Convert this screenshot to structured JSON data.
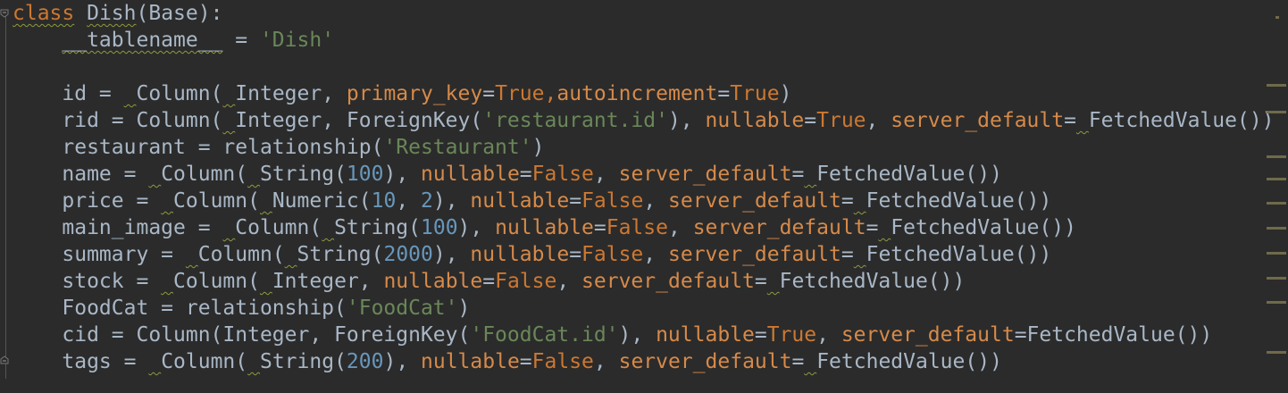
{
  "code": {
    "lines": [
      [
        {
          "t": "class",
          "c": "kw"
        },
        {
          "t": " ",
          "c": ""
        },
        {
          "t": "Dish",
          "c": ""
        },
        {
          "t": "(",
          "c": ""
        },
        {
          "t": "Base",
          "c": ""
        },
        {
          "t": "):",
          "c": ""
        }
      ],
      [
        {
          "t": "    ",
          "c": ""
        },
        {
          "t": "__tablename__",
          "c": ""
        },
        {
          "t": " = ",
          "c": ""
        },
        {
          "t": "'Dish'",
          "c": "str"
        }
      ],
      [],
      [
        {
          "t": "    id = ",
          "c": ""
        },
        {
          "t": " ",
          "c": ""
        },
        {
          "t": "Column(",
          "c": ""
        },
        {
          "t": " ",
          "c": ""
        },
        {
          "t": "Integer, ",
          "c": ""
        },
        {
          "t": "primary_key",
          "c": "param"
        },
        {
          "t": "=",
          "c": ""
        },
        {
          "t": "True",
          "c": "kw"
        },
        {
          "t": ",",
          "c": "kw"
        },
        {
          "t": "autoincrement",
          "c": "param"
        },
        {
          "t": "=",
          "c": ""
        },
        {
          "t": "True",
          "c": "kw"
        },
        {
          "t": ")",
          "c": ""
        }
      ],
      [
        {
          "t": "    rid = Column(",
          "c": ""
        },
        {
          "t": " ",
          "c": ""
        },
        {
          "t": "Integer, ForeignKey(",
          "c": ""
        },
        {
          "t": "'restaurant.id'",
          "c": "str"
        },
        {
          "t": "), ",
          "c": ""
        },
        {
          "t": "nullable",
          "c": "param"
        },
        {
          "t": "=",
          "c": ""
        },
        {
          "t": "True",
          "c": "kw"
        },
        {
          "t": ", ",
          "c": ""
        },
        {
          "t": "server_default",
          "c": "param"
        },
        {
          "t": "=",
          "c": ""
        },
        {
          "t": " ",
          "c": ""
        },
        {
          "t": "FetchedValue())",
          "c": ""
        }
      ],
      [
        {
          "t": "    restaurant = relationship(",
          "c": ""
        },
        {
          "t": "'Restaurant'",
          "c": "str"
        },
        {
          "t": ")",
          "c": ""
        }
      ],
      [
        {
          "t": "    name = ",
          "c": ""
        },
        {
          "t": " ",
          "c": ""
        },
        {
          "t": "Column(",
          "c": ""
        },
        {
          "t": " ",
          "c": ""
        },
        {
          "t": "String(",
          "c": ""
        },
        {
          "t": "100",
          "c": "num"
        },
        {
          "t": "), ",
          "c": ""
        },
        {
          "t": "nullable",
          "c": "param"
        },
        {
          "t": "=",
          "c": ""
        },
        {
          "t": "False",
          "c": "kw"
        },
        {
          "t": ", ",
          "c": ""
        },
        {
          "t": "server_default",
          "c": "param"
        },
        {
          "t": "=",
          "c": ""
        },
        {
          "t": " ",
          "c": ""
        },
        {
          "t": "FetchedValue())",
          "c": ""
        }
      ],
      [
        {
          "t": "    price = ",
          "c": ""
        },
        {
          "t": " ",
          "c": ""
        },
        {
          "t": "Column(",
          "c": ""
        },
        {
          "t": " ",
          "c": ""
        },
        {
          "t": "Numeric(",
          "c": ""
        },
        {
          "t": "10",
          "c": "num"
        },
        {
          "t": ", ",
          "c": ""
        },
        {
          "t": "2",
          "c": "num"
        },
        {
          "t": "), ",
          "c": ""
        },
        {
          "t": "nullable",
          "c": "param"
        },
        {
          "t": "=",
          "c": ""
        },
        {
          "t": "False",
          "c": "kw"
        },
        {
          "t": ", ",
          "c": ""
        },
        {
          "t": "server_default",
          "c": "param"
        },
        {
          "t": "=",
          "c": ""
        },
        {
          "t": " ",
          "c": ""
        },
        {
          "t": "FetchedValue())",
          "c": ""
        }
      ],
      [
        {
          "t": "    main_image = ",
          "c": ""
        },
        {
          "t": " ",
          "c": ""
        },
        {
          "t": "Column(",
          "c": ""
        },
        {
          "t": " ",
          "c": ""
        },
        {
          "t": "String(",
          "c": ""
        },
        {
          "t": "100",
          "c": "num"
        },
        {
          "t": "), ",
          "c": ""
        },
        {
          "t": "nullable",
          "c": "param"
        },
        {
          "t": "=",
          "c": ""
        },
        {
          "t": "False",
          "c": "kw"
        },
        {
          "t": ", ",
          "c": ""
        },
        {
          "t": "server_default",
          "c": "param"
        },
        {
          "t": "=",
          "c": ""
        },
        {
          "t": " ",
          "c": ""
        },
        {
          "t": "FetchedValue())",
          "c": ""
        }
      ],
      [
        {
          "t": "    summary = ",
          "c": ""
        },
        {
          "t": " ",
          "c": ""
        },
        {
          "t": "Column(",
          "c": ""
        },
        {
          "t": " ",
          "c": ""
        },
        {
          "t": "String(",
          "c": ""
        },
        {
          "t": "2000",
          "c": "num"
        },
        {
          "t": "), ",
          "c": ""
        },
        {
          "t": "nullable",
          "c": "param"
        },
        {
          "t": "=",
          "c": ""
        },
        {
          "t": "False",
          "c": "kw"
        },
        {
          "t": ", ",
          "c": ""
        },
        {
          "t": "server_default",
          "c": "param"
        },
        {
          "t": "=",
          "c": ""
        },
        {
          "t": " ",
          "c": ""
        },
        {
          "t": "FetchedValue())",
          "c": ""
        }
      ],
      [
        {
          "t": "    stock = ",
          "c": ""
        },
        {
          "t": " ",
          "c": ""
        },
        {
          "t": "Column(",
          "c": ""
        },
        {
          "t": " ",
          "c": ""
        },
        {
          "t": "Integer, ",
          "c": ""
        },
        {
          "t": "nullable",
          "c": "param"
        },
        {
          "t": "=",
          "c": ""
        },
        {
          "t": "False",
          "c": "kw"
        },
        {
          "t": ", ",
          "c": ""
        },
        {
          "t": "server_default",
          "c": "param"
        },
        {
          "t": "=",
          "c": ""
        },
        {
          "t": " ",
          "c": ""
        },
        {
          "t": "FetchedValue())",
          "c": ""
        }
      ],
      [
        {
          "t": "    FoodCat = relationship(",
          "c": ""
        },
        {
          "t": "'FoodCat'",
          "c": "str"
        },
        {
          "t": ")",
          "c": ""
        }
      ],
      [
        {
          "t": "    cid = Column(Integer, ForeignKey(",
          "c": ""
        },
        {
          "t": "'FoodCat.id'",
          "c": "str"
        },
        {
          "t": "), ",
          "c": ""
        },
        {
          "t": "nullable",
          "c": "param"
        },
        {
          "t": "=",
          "c": ""
        },
        {
          "t": "True",
          "c": "kw"
        },
        {
          "t": ", ",
          "c": ""
        },
        {
          "t": "server_default",
          "c": "param"
        },
        {
          "t": "=FetchedValue())",
          "c": ""
        }
      ],
      [
        {
          "t": "    tags = ",
          "c": ""
        },
        {
          "t": " ",
          "c": ""
        },
        {
          "t": "Column(",
          "c": ""
        },
        {
          "t": " ",
          "c": ""
        },
        {
          "t": "String(",
          "c": ""
        },
        {
          "t": "200",
          "c": "num"
        },
        {
          "t": "), ",
          "c": ""
        },
        {
          "t": "nullable",
          "c": "param"
        },
        {
          "t": "=",
          "c": ""
        },
        {
          "t": "False",
          "c": "kw"
        },
        {
          "t": ", ",
          "c": ""
        },
        {
          "t": "server_default",
          "c": "param"
        },
        {
          "t": "=",
          "c": ""
        },
        {
          "t": " ",
          "c": ""
        },
        {
          "t": "FetchedValue())",
          "c": ""
        }
      ]
    ]
  },
  "colors": {
    "background": "#2b2b2b",
    "default_text": "#a9b7c6",
    "keyword": "#cc7832",
    "parameter": "#d68a4a",
    "string": "#6a8759",
    "number": "#6897bb",
    "weak_warning": "#8e9b3c"
  },
  "icons": {
    "fold_top": "fold-collapse-icon",
    "fold_bottom": "fold-expand-icon"
  }
}
